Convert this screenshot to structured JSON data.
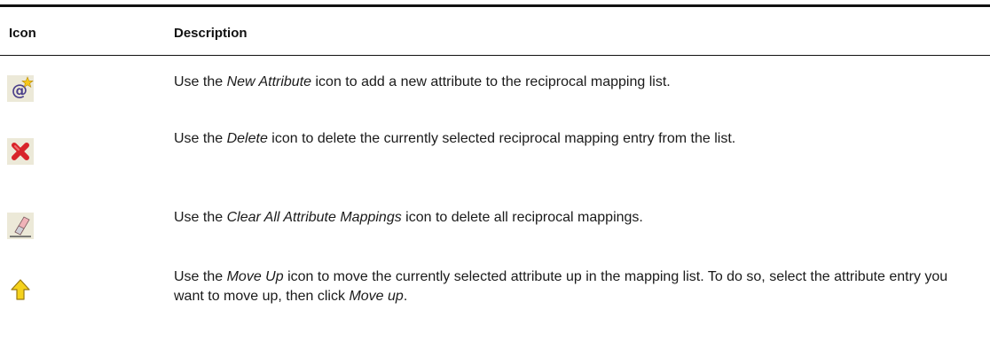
{
  "table": {
    "headers": {
      "icon": "Icon",
      "description": "Description"
    },
    "rows": [
      {
        "icon": "new-attribute-icon",
        "pre": "Use the ",
        "term": "New Attribute",
        "post": " icon to add a new attribute to the reciprocal mapping list.",
        "extra": "",
        "term2": "",
        "post2": ""
      },
      {
        "icon": "delete-icon",
        "pre": "Use the ",
        "term": "Delete",
        "post": " icon to delete the currently selected reciprocal mapping entry from the list.",
        "extra": "",
        "term2": "",
        "post2": ""
      },
      {
        "icon": "eraser-icon",
        "pre": "Use the ",
        "term": "Clear All Attribute Mappings",
        "post": " icon to delete all reciprocal mappings.",
        "extra": "",
        "term2": "",
        "post2": ""
      },
      {
        "icon": "arrow-up-icon",
        "pre": "Use the ",
        "term": "Move Up",
        "post": " icon to move the currently selected attribute up in the mapping list. To do so, select the attribute entry you want to move up, then click ",
        "extra": "",
        "term2": "Move up",
        "post2": "."
      }
    ]
  },
  "colors": {
    "rule": "#111111",
    "icon_bg": "#ece9d8",
    "delete_red": "#d8242a",
    "arrow_yellow": "#f5d21c"
  }
}
